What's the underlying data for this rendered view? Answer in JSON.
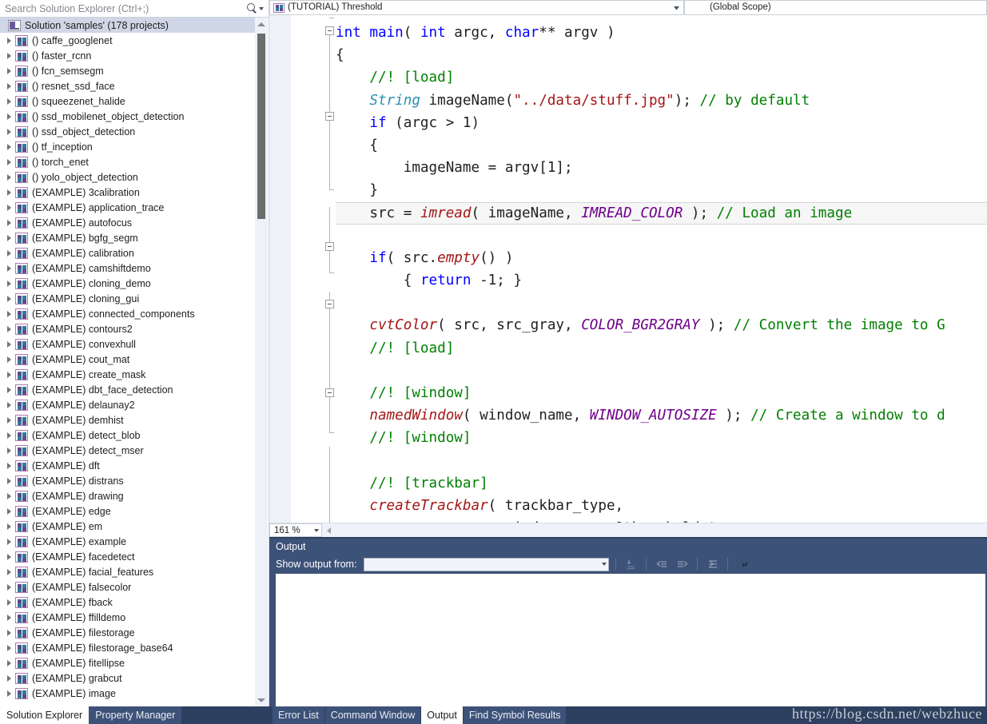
{
  "solution_explorer": {
    "search": {
      "placeholder": "Search Solution Explorer (Ctrl+;)",
      "icon": "search-icon",
      "dropdown_icon": "chevron-down-icon"
    },
    "solution_node": {
      "label": "Solution 'samples' (178 projects)",
      "icon": "solution-icon"
    },
    "projects": [
      {
        "label": "() caffe_googlenet"
      },
      {
        "label": "() faster_rcnn"
      },
      {
        "label": "() fcn_semsegm"
      },
      {
        "label": "() resnet_ssd_face"
      },
      {
        "label": "() squeezenet_halide"
      },
      {
        "label": "() ssd_mobilenet_object_detection"
      },
      {
        "label": "() ssd_object_detection"
      },
      {
        "label": "() tf_inception"
      },
      {
        "label": "() torch_enet"
      },
      {
        "label": "() yolo_object_detection"
      },
      {
        "label": "(EXAMPLE) 3calibration"
      },
      {
        "label": "(EXAMPLE) application_trace"
      },
      {
        "label": "(EXAMPLE) autofocus"
      },
      {
        "label": "(EXAMPLE) bgfg_segm"
      },
      {
        "label": "(EXAMPLE) calibration"
      },
      {
        "label": "(EXAMPLE) camshiftdemo"
      },
      {
        "label": "(EXAMPLE) cloning_demo"
      },
      {
        "label": "(EXAMPLE) cloning_gui"
      },
      {
        "label": "(EXAMPLE) connected_components"
      },
      {
        "label": "(EXAMPLE) contours2"
      },
      {
        "label": "(EXAMPLE) convexhull"
      },
      {
        "label": "(EXAMPLE) cout_mat"
      },
      {
        "label": "(EXAMPLE) create_mask"
      },
      {
        "label": "(EXAMPLE) dbt_face_detection"
      },
      {
        "label": "(EXAMPLE) delaunay2"
      },
      {
        "label": "(EXAMPLE) demhist"
      },
      {
        "label": "(EXAMPLE) detect_blob"
      },
      {
        "label": "(EXAMPLE) detect_mser"
      },
      {
        "label": "(EXAMPLE) dft"
      },
      {
        "label": "(EXAMPLE) distrans"
      },
      {
        "label": "(EXAMPLE) drawing"
      },
      {
        "label": "(EXAMPLE) edge"
      },
      {
        "label": "(EXAMPLE) em"
      },
      {
        "label": "(EXAMPLE) example"
      },
      {
        "label": "(EXAMPLE) facedetect"
      },
      {
        "label": "(EXAMPLE) facial_features"
      },
      {
        "label": "(EXAMPLE) falsecolor"
      },
      {
        "label": "(EXAMPLE) fback"
      },
      {
        "label": "(EXAMPLE) ffilldemo"
      },
      {
        "label": "(EXAMPLE) filestorage"
      },
      {
        "label": "(EXAMPLE) filestorage_base64"
      },
      {
        "label": "(EXAMPLE) fitellipse"
      },
      {
        "label": "(EXAMPLE) grabcut"
      },
      {
        "label": "(EXAMPLE) image"
      }
    ],
    "tabs": [
      {
        "label": "Solution Explorer",
        "active": true
      },
      {
        "label": "Property Manager",
        "active": false
      }
    ]
  },
  "editor": {
    "nav_bar": {
      "project_combo": "(TUTORIAL) Threshold",
      "scope_combo": "(Global Scope)",
      "project_icon": "project-icon",
      "dropdown_icon": "chevron-down-icon"
    },
    "zoom": {
      "value": "161 %",
      "dropdown_icon": "chevron-down-icon"
    },
    "code_lines": [
      {
        "current": false,
        "tokens": [
          {
            "t": "int",
            "c": "kw"
          },
          {
            "t": " ",
            "c": "txt"
          },
          {
            "t": "main",
            "c": "kw"
          },
          {
            "t": "( ",
            "c": "txt"
          },
          {
            "t": "int",
            "c": "kw"
          },
          {
            "t": " argc, ",
            "c": "txt"
          },
          {
            "t": "char",
            "c": "kw"
          },
          {
            "t": "** argv )",
            "c": "txt"
          }
        ],
        "indent": 0
      },
      {
        "current": false,
        "tokens": [
          {
            "t": "{",
            "c": "txt"
          }
        ],
        "indent": 0
      },
      {
        "current": false,
        "tokens": [
          {
            "t": "//! [load]",
            "c": "cmt"
          }
        ],
        "indent": 1
      },
      {
        "current": false,
        "tokens": [
          {
            "t": "String",
            "c": "type"
          },
          {
            "t": " imageName(",
            "c": "txt"
          },
          {
            "t": "\"../data/stuff.jpg\"",
            "c": "str"
          },
          {
            "t": "); ",
            "c": "txt"
          },
          {
            "t": "// by default",
            "c": "cmt"
          }
        ],
        "indent": 1
      },
      {
        "current": false,
        "tokens": [
          {
            "t": "if",
            "c": "kw"
          },
          {
            "t": " (argc > ",
            "c": "txt"
          },
          {
            "t": "1",
            "c": "txt"
          },
          {
            "t": ")",
            "c": "txt"
          }
        ],
        "indent": 1
      },
      {
        "current": false,
        "tokens": [
          {
            "t": "{",
            "c": "txt"
          }
        ],
        "indent": 1
      },
      {
        "current": false,
        "tokens": [
          {
            "t": "imageName = argv[1];",
            "c": "txt"
          }
        ],
        "indent": 2
      },
      {
        "current": false,
        "tokens": [
          {
            "t": "}",
            "c": "txt"
          }
        ],
        "indent": 1
      },
      {
        "current": true,
        "tokens": [
          {
            "t": "src = ",
            "c": "txt"
          },
          {
            "t": "imread",
            "c": "fn"
          },
          {
            "t": "( imageName, ",
            "c": "txt"
          },
          {
            "t": "IMREAD_COLOR",
            "c": "mac"
          },
          {
            "t": " ); ",
            "c": "txt"
          },
          {
            "t": "// Load an image",
            "c": "cmt"
          }
        ],
        "indent": 1
      },
      {
        "current": false,
        "tokens": [],
        "indent": 0
      },
      {
        "current": false,
        "tokens": [
          {
            "t": "if",
            "c": "kw"
          },
          {
            "t": "( src.",
            "c": "txt"
          },
          {
            "t": "empty",
            "c": "fn"
          },
          {
            "t": "() )",
            "c": "txt"
          }
        ],
        "indent": 1
      },
      {
        "current": false,
        "tokens": [
          {
            "t": "{ ",
            "c": "txt"
          },
          {
            "t": "return",
            "c": "kw"
          },
          {
            "t": " -1; }",
            "c": "txt"
          }
        ],
        "indent": 2
      },
      {
        "current": false,
        "tokens": [],
        "indent": 0
      },
      {
        "current": false,
        "tokens": [
          {
            "t": "cvtColor",
            "c": "fn"
          },
          {
            "t": "( src, src_gray, ",
            "c": "txt"
          },
          {
            "t": "COLOR_BGR2GRAY",
            "c": "mac"
          },
          {
            "t": " ); ",
            "c": "txt"
          },
          {
            "t": "// Convert the image to G",
            "c": "cmt"
          }
        ],
        "indent": 1
      },
      {
        "current": false,
        "tokens": [
          {
            "t": "//! [load]",
            "c": "cmt"
          }
        ],
        "indent": 1
      },
      {
        "current": false,
        "tokens": [],
        "indent": 0
      },
      {
        "current": false,
        "tokens": [
          {
            "t": "//! [window]",
            "c": "cmt"
          }
        ],
        "indent": 1
      },
      {
        "current": false,
        "tokens": [
          {
            "t": "namedWindow",
            "c": "fn"
          },
          {
            "t": "( window_name, ",
            "c": "txt"
          },
          {
            "t": "WINDOW_AUTOSIZE",
            "c": "mac"
          },
          {
            "t": " ); ",
            "c": "txt"
          },
          {
            "t": "// Create a window to d",
            "c": "cmt"
          }
        ],
        "indent": 1
      },
      {
        "current": false,
        "tokens": [
          {
            "t": "//! [window]",
            "c": "cmt"
          }
        ],
        "indent": 1
      },
      {
        "current": false,
        "tokens": [],
        "indent": 0
      },
      {
        "current": false,
        "tokens": [
          {
            "t": "//! [trackbar]",
            "c": "cmt"
          }
        ],
        "indent": 1
      },
      {
        "current": false,
        "tokens": [
          {
            "t": "createTrackbar",
            "c": "fn"
          },
          {
            "t": "( trackbar_type,",
            "c": "txt"
          }
        ],
        "indent": 1
      },
      {
        "current": false,
        "tokens": [
          {
            "t": "window_name, &threshold_type,",
            "c": "txt"
          }
        ],
        "indent": 5
      }
    ]
  },
  "output_panel": {
    "title": "Output",
    "show_output_from_label": "Show output from:",
    "show_output_from_value": "",
    "toolbar_icons": [
      "clear-output-icon",
      "navigate-previous-icon",
      "navigate-next-icon",
      "toggle-wordwrap-icon",
      "line-return-icon"
    ],
    "watermark": "https://blog.csdn.net/webzhuce"
  },
  "bottom_tabs": [
    {
      "label": "Error List",
      "active": false
    },
    {
      "label": "Command Window",
      "active": false
    },
    {
      "label": "Output",
      "active": true
    },
    {
      "label": "Find Symbol Results",
      "active": false
    }
  ]
}
